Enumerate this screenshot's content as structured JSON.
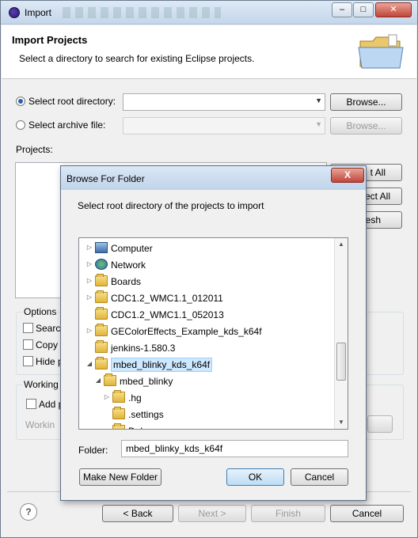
{
  "window": {
    "title": "Import"
  },
  "header": {
    "title": "Import Projects",
    "subtitle": "Select a directory to search for existing Eclipse projects."
  },
  "main": {
    "select_root_label": "Select root directory:",
    "select_archive_label": "Select archive file:",
    "root_value": "",
    "browse_label": "Browse...",
    "browse_archive_label": "Browse...",
    "projects_label": "Projects:",
    "select_all_partial": "t All",
    "deselect_all_partial": "ect All",
    "refresh_partial": "esh",
    "options_label": "Options",
    "search_partial": "Search",
    "copy_partial": "Copy",
    "hide_partial": "Hide p",
    "working_label": "Working",
    "add_partial": "Add p",
    "working_sets_partial": "Workin"
  },
  "footer": {
    "help": "?",
    "back": "< Back",
    "next": "Next >",
    "finish": "Finish",
    "cancel": "Cancel"
  },
  "dialog": {
    "title": "Browse For Folder",
    "close": "X",
    "instruction": "Select root directory of the projects to import",
    "tree": [
      {
        "label": "Computer",
        "icon": "computer-icon",
        "indent": 0,
        "twisty": "collapsed"
      },
      {
        "label": "Network",
        "icon": "network-icon",
        "indent": 0,
        "twisty": "collapsed"
      },
      {
        "label": "Boards",
        "icon": "folder-icon",
        "indent": 0,
        "twisty": "collapsed"
      },
      {
        "label": "CDC1.2_WMC1.1_012011",
        "icon": "folder-icon",
        "indent": 0,
        "twisty": "collapsed"
      },
      {
        "label": "CDC1.2_WMC1.1_052013",
        "icon": "folder-icon",
        "indent": 0,
        "twisty": "none"
      },
      {
        "label": "GEColorEffects_Example_kds_k64f",
        "icon": "folder-icon",
        "indent": 0,
        "twisty": "collapsed"
      },
      {
        "label": "jenkins-1.580.3",
        "icon": "folder-icon",
        "indent": 0,
        "twisty": "none"
      },
      {
        "label": "mbed_blinky_kds_k64f",
        "icon": "folder-icon",
        "indent": 0,
        "twisty": "expanded",
        "selected": true
      },
      {
        "label": "mbed_blinky",
        "icon": "folder-icon",
        "indent": 1,
        "twisty": "expanded"
      },
      {
        "label": ".hg",
        "icon": "folder-icon",
        "indent": 2,
        "twisty": "collapsed"
      },
      {
        "label": ".settings",
        "icon": "folder-icon",
        "indent": 2,
        "twisty": "none"
      },
      {
        "label": "Debug",
        "icon": "folder-icon",
        "indent": 2,
        "twisty": "none"
      }
    ],
    "folder_label": "Folder:",
    "folder_value": "mbed_blinky_kds_k64f",
    "make_new_folder": "Make New Folder",
    "ok": "OK",
    "cancel": "Cancel"
  }
}
